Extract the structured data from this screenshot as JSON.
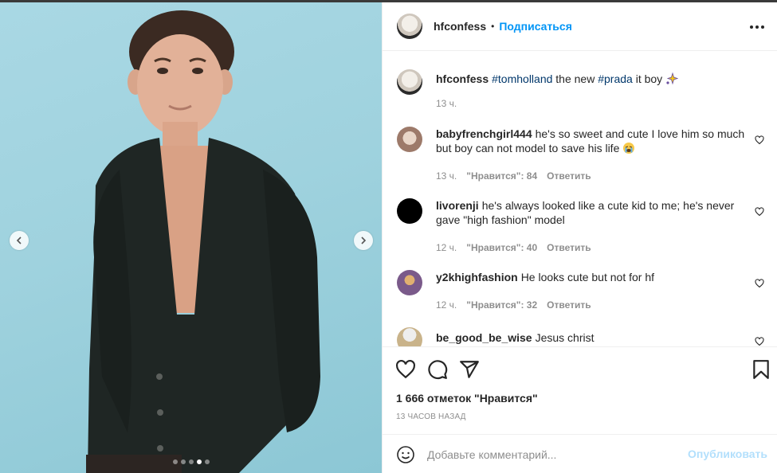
{
  "post": {
    "username": "hfconfess",
    "separator": "•",
    "follow_label": "Подписаться",
    "caption": {
      "username": "hfconfess",
      "tag1": "#tomholland",
      "text1": " the new ",
      "tag2": "#prada",
      "text2": " it boy ",
      "time": "13 ч."
    },
    "media": {
      "slide": 4,
      "total": 5
    }
  },
  "comments": [
    {
      "username": "babyfrenchgirl444",
      "text": "he's so sweet and cute I love him so much but boy can not model to save his life",
      "time": "13 ч.",
      "likes": "\"Нравится\": 84",
      "reply": "Ответить",
      "avatar_color": "#b89a8a"
    },
    {
      "username": "livorenji",
      "text": "he's always looked like a cute kid to me; he's never gave \"high fashion\" model",
      "time": "12 ч.",
      "likes": "\"Нравится\": 40",
      "reply": "Ответить",
      "avatar_color": "#000000"
    },
    {
      "username": "y2khighfashion",
      "text": "He looks cute but not for hf",
      "time": "12 ч.",
      "likes": "\"Нравится\": 32",
      "reply": "Ответить",
      "avatar_color": "#7a5a8a"
    },
    {
      "username": "be_good_be_wise",
      "text": "Jesus christ",
      "avatar_color": "#c9b38a"
    }
  ],
  "footer": {
    "likes_text": "1 666 отметок \"Нравится\"",
    "posted_ago": "13 ЧАСОВ НАЗАД",
    "comment_placeholder": "Добавьте комментарий...",
    "post_label": "Опубликовать"
  },
  "icons": {
    "like": "heart-icon",
    "comment": "comment-icon",
    "share": "share-icon",
    "save": "bookmark-icon",
    "emoji": "smile-icon",
    "more": "more-icon"
  },
  "colors": {
    "link": "#0095f6",
    "hashtag": "#00376b",
    "muted": "#8e8e8e",
    "post_disabled": "#b2dffc"
  }
}
